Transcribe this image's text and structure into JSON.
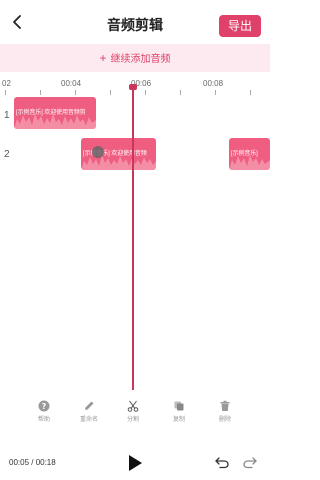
{
  "header": {
    "title": "音频剪辑",
    "export_label": "导出"
  },
  "add_bar": {
    "plus": "+",
    "label": "继续添加音频"
  },
  "ruler": {
    "labels": [
      "02",
      "00:04",
      "00:06",
      "00:08"
    ]
  },
  "tracks": [
    {
      "number": "1",
      "clips": [
        {
          "label": "[示例音乐] 欢迎使用音频剪"
        }
      ]
    },
    {
      "number": "2",
      "clips": [
        {
          "label": "[示例音乐] 欢迎使用音频"
        },
        {
          "label": "[示例音乐]"
        }
      ]
    }
  ],
  "tools": [
    {
      "label": "帮助",
      "icon": "help-icon"
    },
    {
      "label": "重命名",
      "icon": "pencil-icon"
    },
    {
      "label": "分割",
      "icon": "scissors-icon"
    },
    {
      "label": "复制",
      "icon": "copy-icon"
    },
    {
      "label": "删除",
      "icon": "trash-icon"
    }
  ],
  "player": {
    "time": "00:05 / 00:18"
  },
  "colors": {
    "accent": "#e0416a",
    "clip": "#ef5d80",
    "add_bar_bg": "#fdeaf0",
    "playhead": "#c8365a"
  }
}
